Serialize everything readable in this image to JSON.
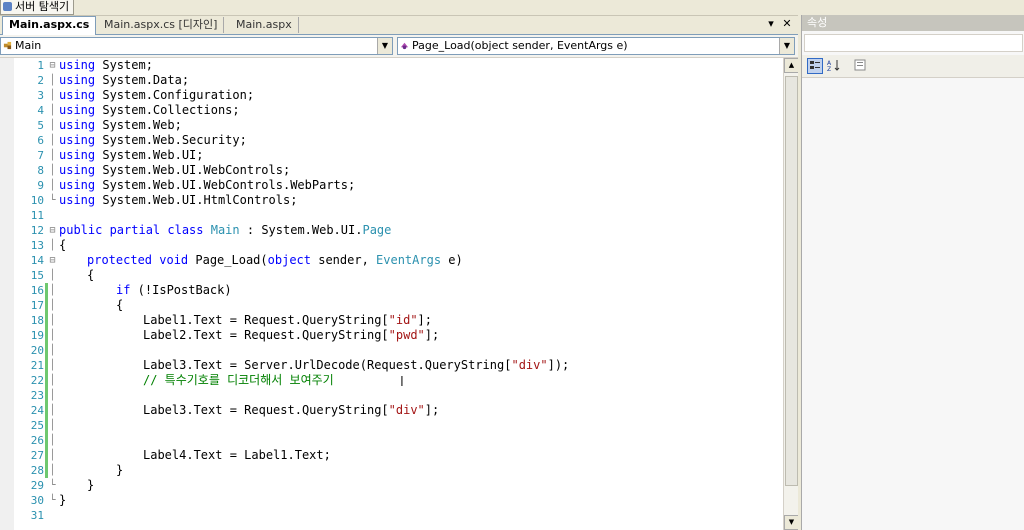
{
  "server_explorer_tab": "서버 탐색기",
  "tabs": [
    {
      "label": "Main.aspx.cs",
      "active": true
    },
    {
      "label": "Main.aspx.cs [디자인]",
      "active": false
    },
    {
      "label": "Main.aspx",
      "active": false
    }
  ],
  "tab_controls": {
    "dropdown": "▾",
    "close": "✕"
  },
  "nav": {
    "class_combo": "Main",
    "member_combo": "Page_Load(object sender, EventArgs e)"
  },
  "properties_panel": {
    "title": "속성",
    "toolbar_icons": [
      "categorized-icon",
      "alphabetical-icon",
      "property-pages-icon"
    ]
  },
  "colors": {
    "keyword": "#0000ff",
    "type": "#2b91af",
    "string": "#a31515",
    "comment": "#008000",
    "line_number": "#2b91af",
    "changed_line_marker": "#6fc86f"
  },
  "code_lines": [
    {
      "n": "1",
      "outline": "⊟",
      "modified": false
    },
    {
      "n": "2",
      "outline": "│",
      "modified": false
    },
    {
      "n": "3",
      "outline": "│",
      "modified": false
    },
    {
      "n": "4",
      "outline": "│",
      "modified": false
    },
    {
      "n": "5",
      "outline": "│",
      "modified": false
    },
    {
      "n": "6",
      "outline": "│",
      "modified": false
    },
    {
      "n": "7",
      "outline": "│",
      "modified": false
    },
    {
      "n": "8",
      "outline": "│",
      "modified": false
    },
    {
      "n": "9",
      "outline": "│",
      "modified": false
    },
    {
      "n": "10",
      "outline": "└",
      "modified": false
    },
    {
      "n": "11",
      "outline": "",
      "modified": false
    },
    {
      "n": "12",
      "outline": "⊟",
      "modified": false
    },
    {
      "n": "13",
      "outline": "│",
      "modified": false
    },
    {
      "n": "14",
      "outline": "⊟",
      "modified": false
    },
    {
      "n": "15",
      "outline": "│",
      "modified": false
    },
    {
      "n": "16",
      "outline": "│",
      "modified": true
    },
    {
      "n": "17",
      "outline": "│",
      "modified": true
    },
    {
      "n": "18",
      "outline": "│",
      "modified": true
    },
    {
      "n": "19",
      "outline": "│",
      "modified": true
    },
    {
      "n": "20",
      "outline": "│",
      "modified": true
    },
    {
      "n": "21",
      "outline": "│",
      "modified": true
    },
    {
      "n": "22",
      "outline": "│",
      "modified": true
    },
    {
      "n": "23",
      "outline": "│",
      "modified": true
    },
    {
      "n": "24",
      "outline": "│",
      "modified": true
    },
    {
      "n": "25",
      "outline": "│",
      "modified": true
    },
    {
      "n": "26",
      "outline": "│",
      "modified": true
    },
    {
      "n": "27",
      "outline": "│",
      "modified": true
    },
    {
      "n": "28",
      "outline": "│",
      "modified": true
    },
    {
      "n": "29",
      "outline": "└",
      "modified": false
    },
    {
      "n": "30",
      "outline": "└",
      "modified": false
    },
    {
      "n": "31",
      "outline": "",
      "modified": false
    }
  ],
  "code": {
    "l1": {
      "k": "using",
      "t": " System;"
    },
    "l2": {
      "k": "using",
      "t": " System.Data;"
    },
    "l3": {
      "k": "using",
      "t": " System.Configuration;"
    },
    "l4": {
      "k": "using",
      "t": " System.Collections;"
    },
    "l5": {
      "k": "using",
      "t": " System.Web;"
    },
    "l6": {
      "k": "using",
      "t": " System.Web.Security;"
    },
    "l7": {
      "k": "using",
      "t": " System.Web.UI;"
    },
    "l8": {
      "k": "using",
      "t": " System.Web.UI.WebControls;"
    },
    "l9": {
      "k": "using",
      "t": " System.Web.UI.WebControls.WebParts;"
    },
    "l10": {
      "k": "using",
      "t": " System.Web.UI.HtmlControls;"
    },
    "l12": {
      "k": "public partial class",
      "c": "Main",
      "t": " : System.Web.UI.",
      "b": "Page"
    },
    "l13": "{",
    "l14": {
      "k": "protected void",
      "t1": " Page_Load(",
      "k2": "object",
      "t2": " sender, ",
      "c": "EventArgs",
      "t3": " e)"
    },
    "l15": "{",
    "l16": {
      "k": "if",
      "t": " (!IsPostBack)"
    },
    "l17": "{",
    "l18": {
      "a": "Label1.Text = Request.QueryString[",
      "s": "\"id\"",
      "b": "];"
    },
    "l19": {
      "a": "Label2.Text = Request.QueryString[",
      "s": "\"pwd\"",
      "b": "];"
    },
    "l21": {
      "a": "Label3.Text = Server.UrlDecode(Request.QueryString[",
      "s": "\"div\"",
      "b": "]);"
    },
    "l22": "// 특수기호를 디코더해서 보여주기",
    "l24": {
      "a": "Label3.Text = Request.QueryString[",
      "s": "\"div\"",
      "b": "];"
    },
    "l27": "Label4.Text = Label1.Text;",
    "l28": "}",
    "l29": "}",
    "l30": "}"
  }
}
